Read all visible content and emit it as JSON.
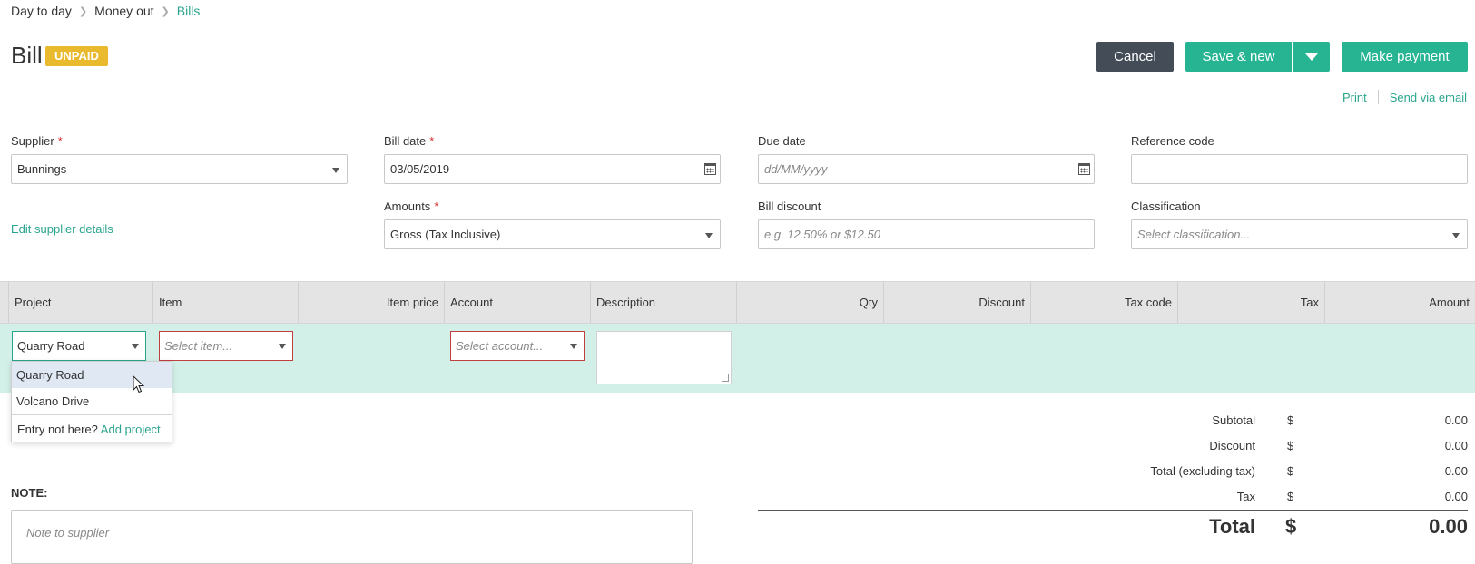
{
  "breadcrumb": [
    "Day to day",
    "Money out",
    "Bills"
  ],
  "page": {
    "title": "Bill",
    "status": "UNPAID"
  },
  "actions": {
    "cancel": "Cancel",
    "save_new": "Save & new",
    "make_payment": "Make payment",
    "print": "Print",
    "send_email": "Send via email"
  },
  "form": {
    "supplier": {
      "label": "Supplier",
      "value": "Bunnings"
    },
    "edit_supplier": "Edit supplier details",
    "bill_date": {
      "label": "Bill date",
      "value": "03/05/2019"
    },
    "due_date": {
      "label": "Due date",
      "placeholder": "dd/MM/yyyy"
    },
    "reference_code": {
      "label": "Reference code",
      "value": ""
    },
    "amounts": {
      "label": "Amounts",
      "value": "Gross (Tax Inclusive)"
    },
    "bill_discount": {
      "label": "Bill discount",
      "placeholder": "e.g. 12.50% or $12.50"
    },
    "classification": {
      "label": "Classification",
      "placeholder": "Select classification..."
    }
  },
  "table": {
    "columns": [
      "Project",
      "Item",
      "Item price",
      "Account",
      "Description",
      "Qty",
      "Discount",
      "Tax code",
      "Tax",
      "Amount"
    ],
    "row": {
      "project": "Quarry Road",
      "item_placeholder": "Select item...",
      "account_placeholder": "Select account..."
    }
  },
  "project_dropdown": {
    "options": [
      "Quarry Road",
      "Volcano Drive"
    ],
    "highlighted": "Quarry Road",
    "footer_text": "Entry not here?",
    "footer_link": "Add project"
  },
  "totals": {
    "currency": "$",
    "rows": [
      {
        "label": "Subtotal",
        "value": "0.00"
      },
      {
        "label": "Discount",
        "value": "0.00"
      },
      {
        "label": "Total (excluding tax)",
        "value": "0.00"
      },
      {
        "label": "Tax",
        "value": "0.00"
      }
    ],
    "grand_label": "Total",
    "grand_value": "0.00"
  },
  "note": {
    "heading": "NOTE:",
    "placeholder": "Note to supplier"
  },
  "colors": {
    "accent": "#27b493",
    "badge": "#e9b92e",
    "cancel": "#444c57",
    "row_bg": "#d3f0e8",
    "error_border": "#c04040"
  }
}
